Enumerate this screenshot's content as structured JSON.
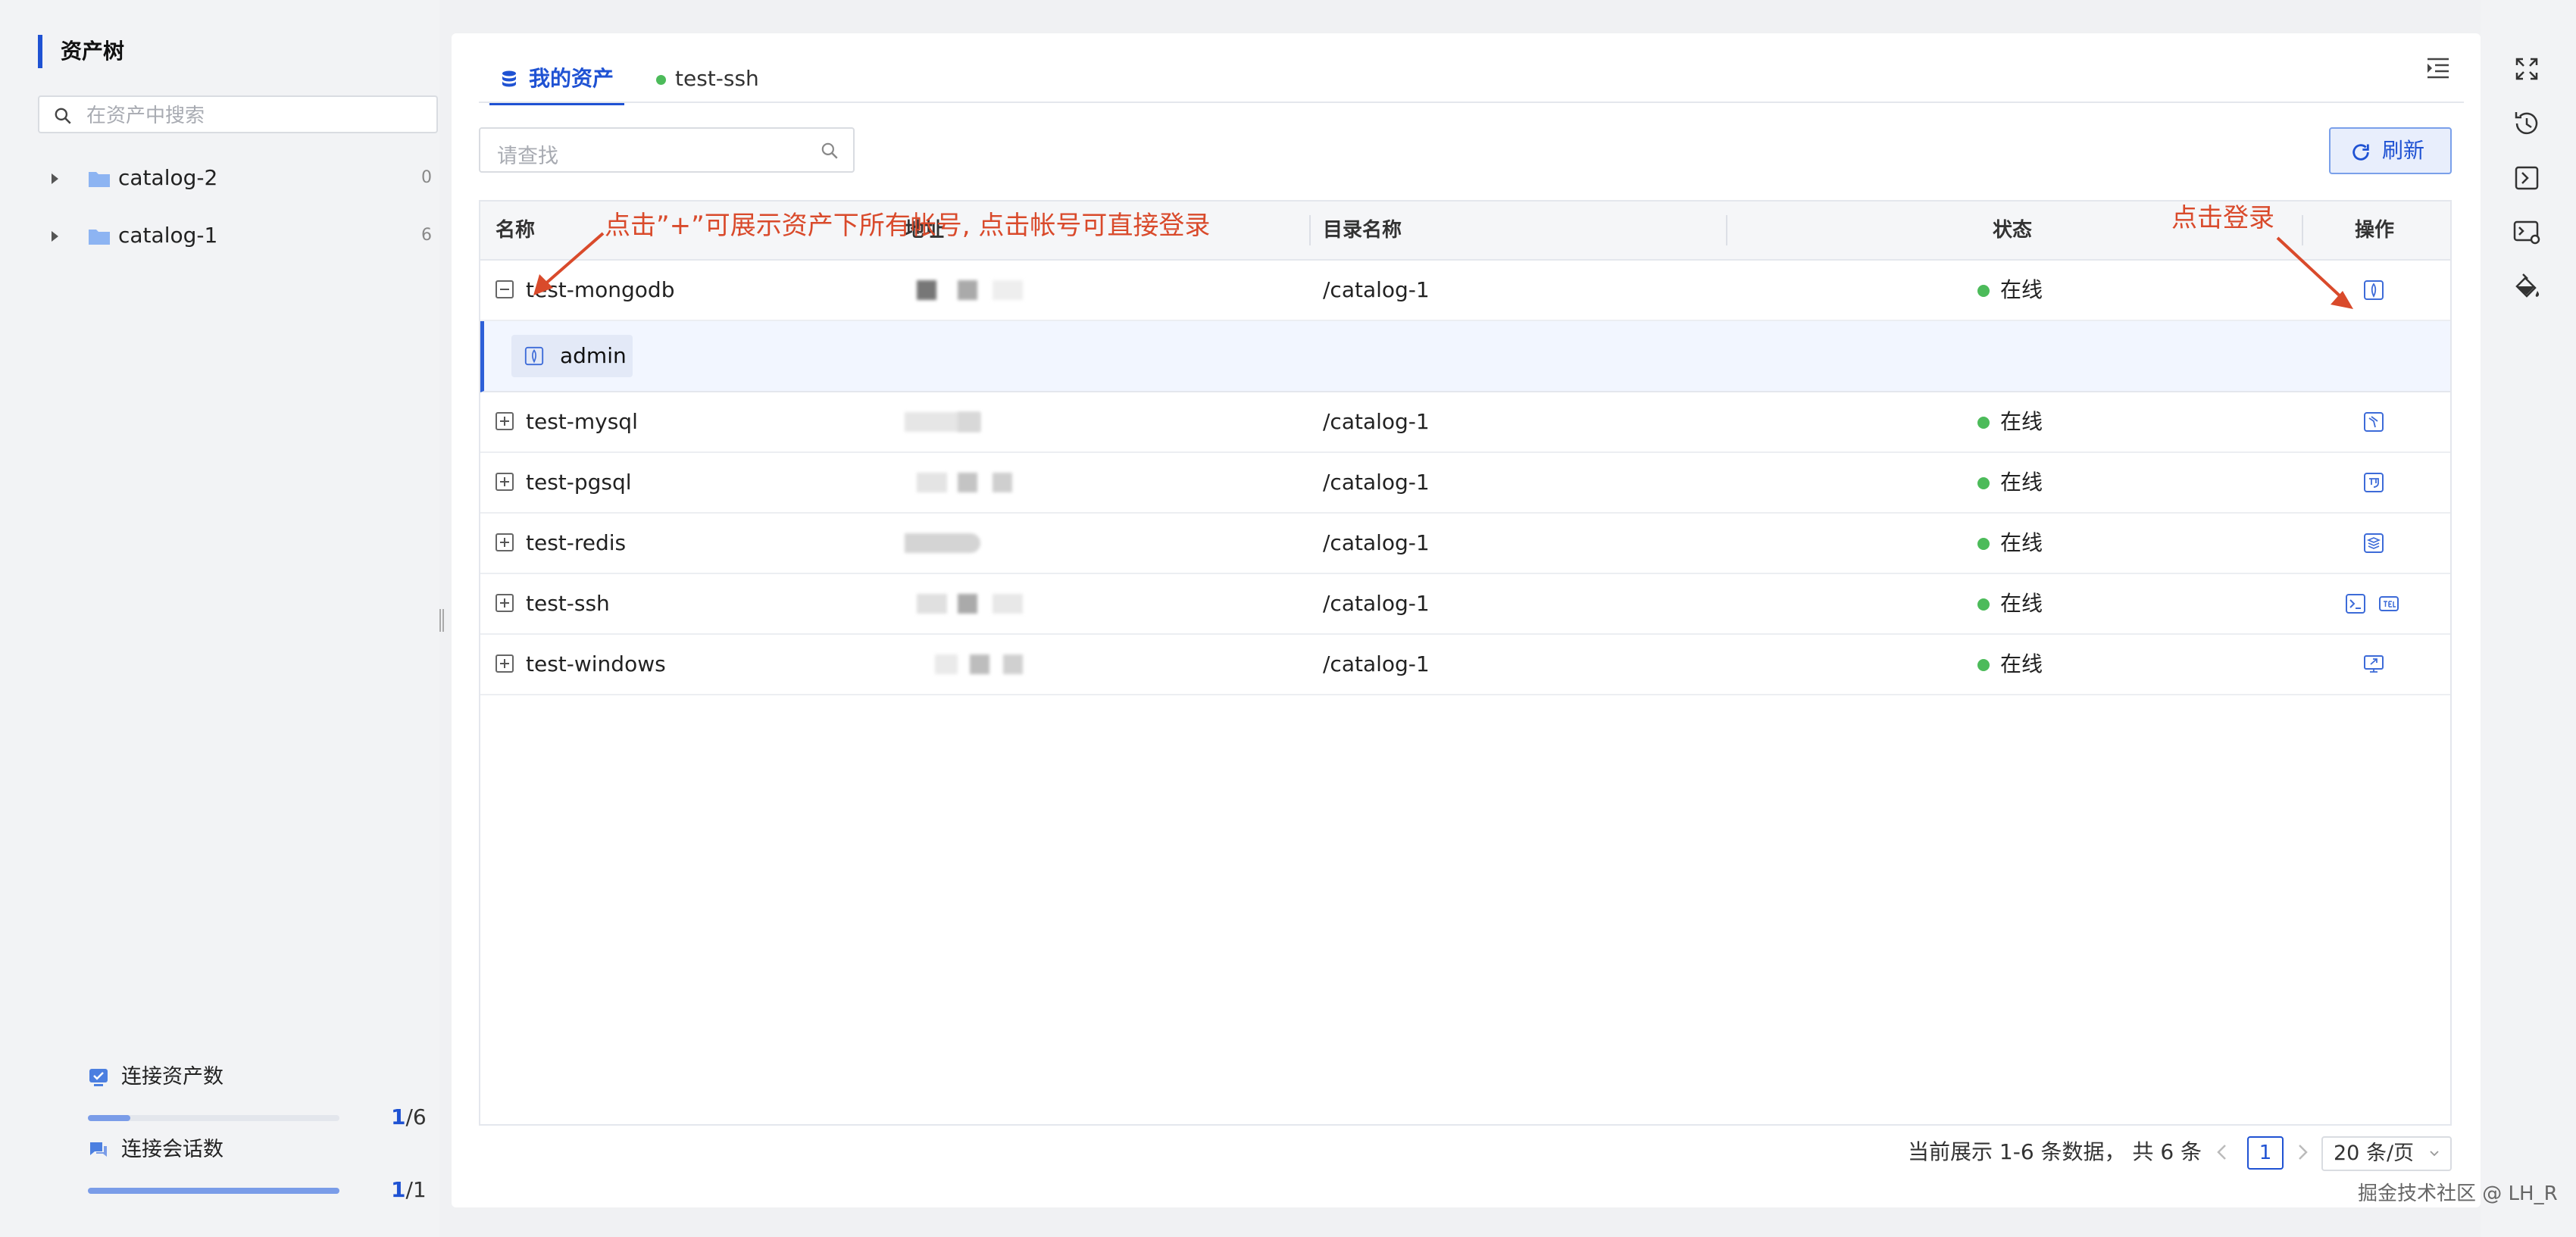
{
  "sidebar": {
    "title": "资产树",
    "search_placeholder": "在资产中搜索",
    "items": [
      {
        "label": "catalog-2",
        "count": "0"
      },
      {
        "label": "catalog-1",
        "count": "6"
      }
    ],
    "stats": [
      {
        "label": "连接资产数",
        "current": "1",
        "total": "/6",
        "progress": 0.17
      },
      {
        "label": "连接会话数",
        "current": "1",
        "total": "/1",
        "progress": 1.0
      }
    ]
  },
  "tabs": [
    {
      "label": "我的资产",
      "active": true
    },
    {
      "label": "test-ssh",
      "active": false
    }
  ],
  "toolbar": {
    "search_placeholder": "请查找",
    "refresh_label": "刷新"
  },
  "table": {
    "headers": {
      "name": "名称",
      "address": "地址",
      "dir": "目录名称",
      "status": "状态",
      "ops": "操作"
    },
    "rows": [
      {
        "name": "test-mongodb",
        "dir": "/catalog-1",
        "status": "在线",
        "expanded": true
      },
      {
        "name": "test-mysql",
        "dir": "/catalog-1",
        "status": "在线"
      },
      {
        "name": "test-pgsql",
        "dir": "/catalog-1",
        "status": "在线"
      },
      {
        "name": "test-redis",
        "dir": "/catalog-1",
        "status": "在线"
      },
      {
        "name": "test-ssh",
        "dir": "/catalog-1",
        "status": "在线"
      },
      {
        "name": "test-windows",
        "dir": "/catalog-1",
        "status": "在线"
      }
    ],
    "sub_account": "admin"
  },
  "annotations": {
    "expand_hint": "点击”+”可展示资产下所有帐号, 点击帐号可直接登录",
    "login_hint": "点击登录"
  },
  "pagination": {
    "summary": "当前展示 1-6 条数据， 共 6 条",
    "page": "1",
    "page_size": "20 条/页"
  },
  "watermark": "掘金技术社区 @ LH_R",
  "colors": {
    "accent": "#1f52d3",
    "online": "#4cbb5a",
    "annotation": "#d94a2b"
  }
}
